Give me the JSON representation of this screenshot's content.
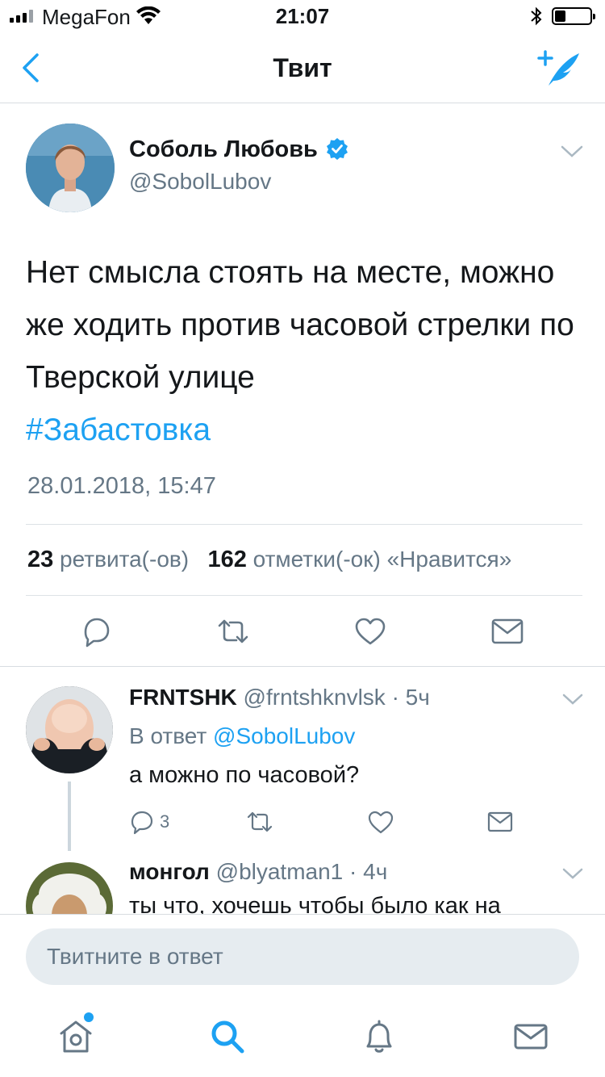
{
  "status_bar": {
    "carrier": "MegaFon",
    "time": "21:07",
    "battery_level": 0.3
  },
  "nav": {
    "title": "Твит"
  },
  "tweet": {
    "author_name": "Соболь Любовь",
    "author_handle": "@SobolLubov",
    "verified": true,
    "text": "Нет смысла стоять на месте, можно же ходить против часовой стрелки по Тверской улице",
    "hashtag": "#Забастовка",
    "timestamp": "28.01.2018, 15:47",
    "retweets_count": "23",
    "retweets_label": "ретвита(-ов)",
    "likes_count": "162",
    "likes_label": "отметки(-ок) «Нравится»"
  },
  "replies": [
    {
      "name": "FRNTSHK",
      "handle": "@frntshknvlsk",
      "time": "· 5ч",
      "reply_to_prefix": "В ответ",
      "reply_to_handle": "@SobolLubov",
      "text": "а можно по часовой?",
      "reply_count": "3"
    },
    {
      "name": "монгол",
      "handle": "@blyatman1",
      "time": "· 4ч",
      "text": "ты что, хочешь чтобы было как на"
    }
  ],
  "composer": {
    "placeholder": "Твитните в ответ"
  },
  "colors": {
    "accent": "#1da1f2",
    "secondary_text": "#657786",
    "primary_text": "#14171a",
    "icon_gray": "#657786"
  },
  "tabs": [
    {
      "name": "home-icon",
      "has_notification_dot": true
    },
    {
      "name": "search-icon",
      "active": true
    },
    {
      "name": "bell-icon"
    },
    {
      "name": "mail-icon"
    }
  ]
}
